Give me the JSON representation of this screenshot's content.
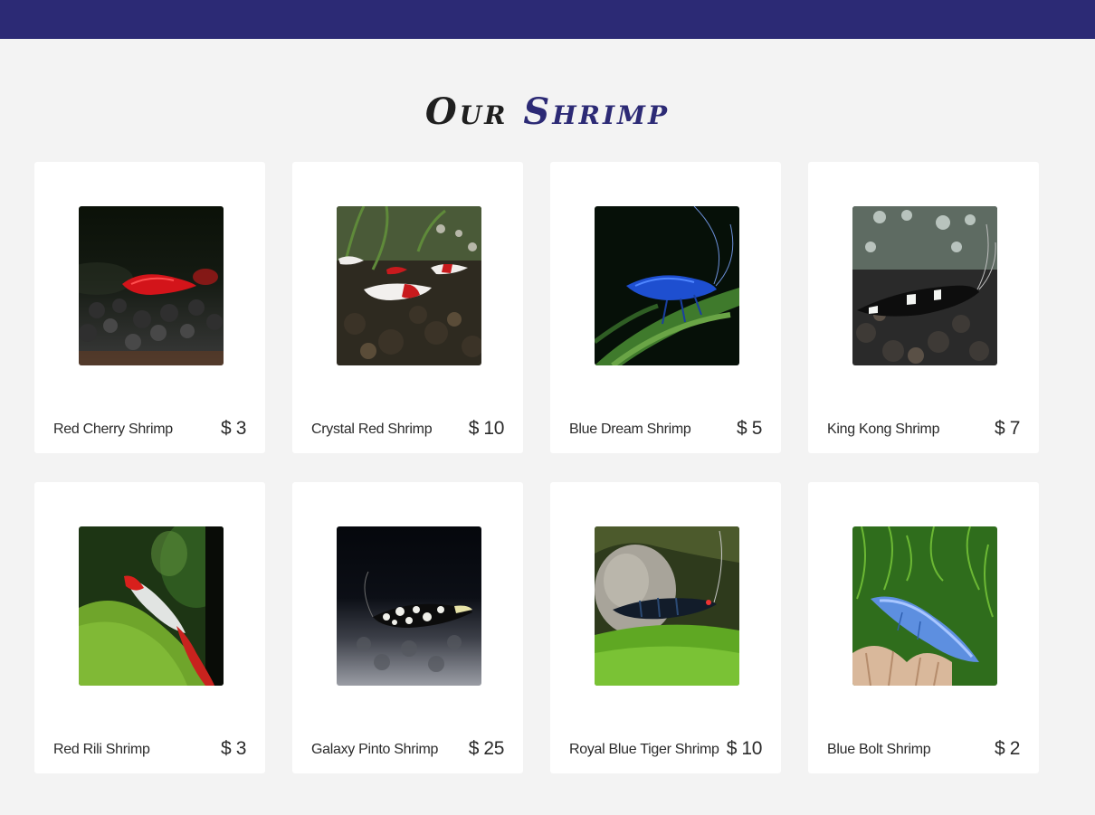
{
  "header": {
    "title_word1": "Our",
    "title_word2": "Shrimp"
  },
  "colors": {
    "brand": "#2c2a75",
    "background": "#f3f3f3",
    "card": "#ffffff"
  },
  "products": [
    {
      "name": "Red Cherry Shrimp",
      "price": "$ 3"
    },
    {
      "name": "Crystal Red Shrimp",
      "price": "$ 10"
    },
    {
      "name": "Blue Dream Shrimp",
      "price": "$ 5"
    },
    {
      "name": "King Kong Shrimp",
      "price": "$ 7"
    },
    {
      "name": "Red Rili Shrimp",
      "price": "$ 3"
    },
    {
      "name": "Galaxy Pinto Shrimp",
      "price": "$ 25"
    },
    {
      "name": "Royal Blue Tiger Shrimp",
      "price": "$ 10"
    },
    {
      "name": "Blue Bolt Shrimp",
      "price": "$ 2"
    }
  ]
}
